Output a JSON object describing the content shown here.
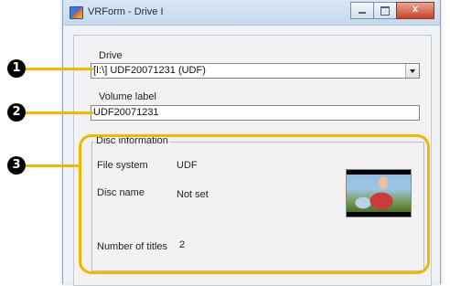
{
  "window": {
    "title": "VRForm - Drive I",
    "buttons": {
      "minimize": "minimize",
      "maximize": "maximize",
      "close": "x"
    }
  },
  "drive": {
    "label": "Drive",
    "selected": "[I:\\] UDF20071231 (UDF)"
  },
  "volume": {
    "label": "Volume label",
    "value": "UDF20071231"
  },
  "disc_info": {
    "legend": "Disc information",
    "file_system_label": "File system",
    "file_system_value": "UDF",
    "disc_name_label": "Disc name",
    "disc_name_value": "Not set",
    "titles_label": "Number of titles",
    "titles_value": "2",
    "thumbnail": "disc-thumbnail-image"
  },
  "callouts": [
    "1",
    "2",
    "3"
  ],
  "colors": {
    "highlight": "#f2b500",
    "badge": "#000000"
  }
}
